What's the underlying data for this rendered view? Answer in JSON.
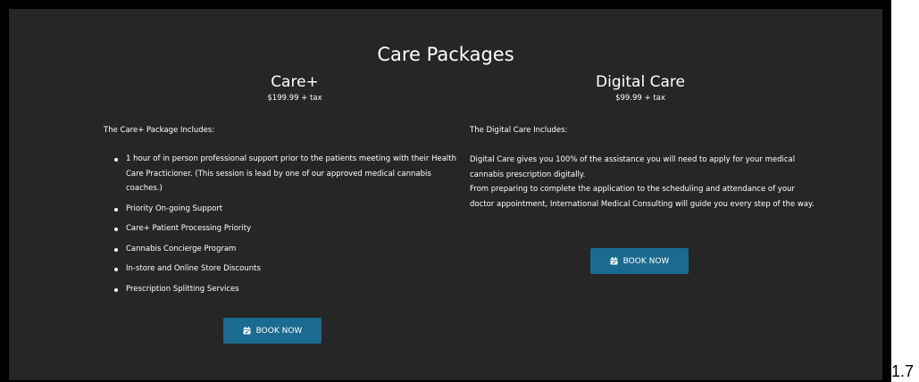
{
  "page": {
    "title": "Care Packages"
  },
  "care_plus": {
    "name": "Care+",
    "price": "$199.99 + tax",
    "intro": "The Care+ Package Includes:",
    "features": [
      "1 hour of in person professional support prior to the patients meeting with their Health Care Practicioner. (This session is lead by one of our approved medical cannabis coaches.)",
      "Priority On-going Support",
      "Care+ Patient Processing Priority",
      "Cannabis Concierge Program",
      "In-store and Online Store Discounts",
      "Prescription Splitting Services"
    ],
    "book_label": "BOOK NOW",
    "book_icon": "calendar-check-icon"
  },
  "digital_care": {
    "name": "Digital Care",
    "price": "$99.99 + tax",
    "intro": "The Digital Care Includes:",
    "paragraphs": [
      "Digital Care gives you 100% of the assistance you will need to apply for your medical cannabis prescription digitally.",
      "From preparing to complete the application to the scheduling and attendance of your doctor appointment, International Medical Consulting will guide you every step of the way."
    ],
    "book_label": "BOOK NOW",
    "book_icon": "calendar-check-icon"
  },
  "corner_text": "1.7",
  "colors": {
    "panel_bg": "#262626",
    "frame_bg": "#000000",
    "button_bg": "#1b6a8f",
    "text": "#ffffff"
  }
}
